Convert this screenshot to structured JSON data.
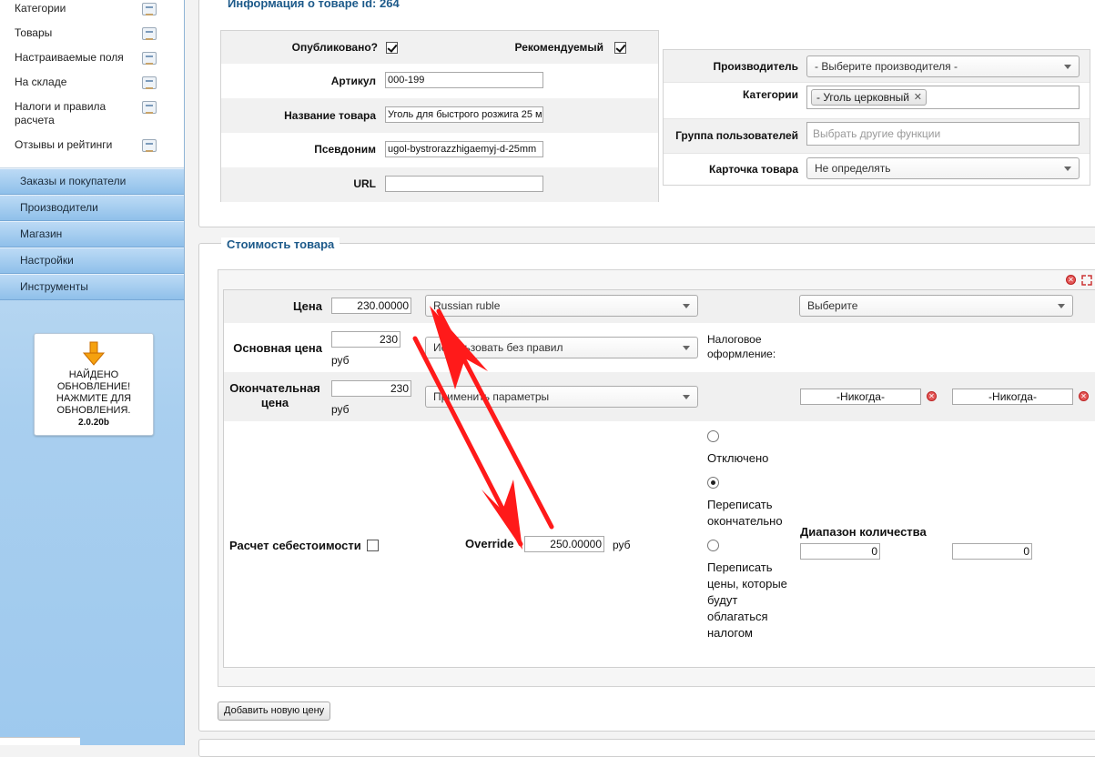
{
  "sidebar": {
    "menu_items": [
      {
        "label": "Категории",
        "icon": "categories-icon"
      },
      {
        "label": "Товары",
        "icon": "products-icon"
      },
      {
        "label": "Настраиваемые поля",
        "icon": "custom-fields-icon"
      },
      {
        "label": "На складе",
        "icon": "stock-icon"
      },
      {
        "label": "Налоги и правила расчета",
        "icon": "taxes-icon"
      },
      {
        "label": "Отзывы и рейтинги",
        "icon": "reviews-icon"
      }
    ],
    "nav": [
      "Заказы и покупатели",
      "Производители",
      "Магазин",
      "Настройки",
      "Инструменты"
    ],
    "update": {
      "line1": "НАЙДЕНО",
      "line2": "ОБНОВЛЕНИЕ!",
      "line3": "НАЖМИТЕ ДЛЯ",
      "line4": "ОБНОВЛЕНИЯ.",
      "version": "2.0.20b"
    }
  },
  "product_info": {
    "legend": "Информация о товаре id: 264",
    "published_label": "Опубликовано?",
    "published": true,
    "featured_label": "Рекомендуемый",
    "featured": true,
    "sku_label": "Артикул",
    "sku": "000-199",
    "name_label": "Название товара",
    "name": "Уголь для быстрого розжига 25 м",
    "alias_label": "Псевдоним",
    "alias": "ugol-bystrorazzhigaemyj-d-25mm",
    "url_label": "URL",
    "url": "",
    "manufacturer_label": "Производитель",
    "manufacturer_value": "- Выберите производителя -",
    "categories_label": "Категории",
    "category_tag": "- Уголь церковный",
    "user_group_label": "Группа пользователей",
    "user_group_placeholder": "Выбрать другие функции",
    "product_card_label": "Карточка товара",
    "product_card_value": "Не определять"
  },
  "price": {
    "legend": "Стоимость товара",
    "price_label": "Цена",
    "price_value": "230.00000",
    "currency": "Russian ruble",
    "shopper_group": "Выберите",
    "base_price_label": "Основная цена",
    "base_price_value": "230",
    "rub": "руб",
    "tax_rule": "Использовать без правил",
    "tax_label": "Налоговое оформление:",
    "final_price_label": "Окончательная цена",
    "final_price_value": "230",
    "discount_rule": "Применить параметры",
    "date_from": "-Никогда-",
    "date_to": "-Никогда-",
    "radio_disabled": "Отключено",
    "radio_override_final": "Переписать окончательно",
    "radio_override_pretax": "Переписать цены, которые будут облагаться налогом",
    "radio_selected": "override_final",
    "cost_label": "Расчет себестоимости",
    "cost_checked": false,
    "override_label": "Override",
    "override_value": "250.00000",
    "override_currency": "руб",
    "qty_range_label": "Диапазон количества",
    "qty_from": "0",
    "qty_to": "0",
    "add_price_button": "Добавить новую цену"
  },
  "annotations": {
    "arrow_color": "#ff1a1a"
  },
  "colors": {
    "legend": "#1d5a8a",
    "nav_blue": "#8fc0ea"
  }
}
